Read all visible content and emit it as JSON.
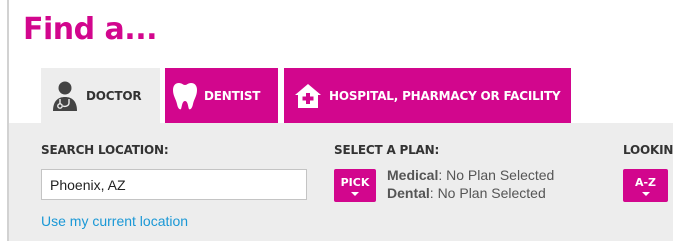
{
  "title": "Find a...",
  "tabs": [
    {
      "label": "DOCTOR",
      "icon": "doctor-icon",
      "active": true
    },
    {
      "label": "DENTIST",
      "icon": "tooth-icon",
      "active": false
    },
    {
      "label": "HOSPITAL, PHARMACY OR FACILITY",
      "icon": "hospital-icon",
      "active": false
    }
  ],
  "search": {
    "label": "SEARCH LOCATION:",
    "value": "Phoenix, AZ",
    "geo_link": "Use my current location"
  },
  "plan": {
    "label": "SELECT A PLAN:",
    "pick_label": "PICK",
    "medical_label": "Medical",
    "medical_value": ": No Plan Selected",
    "dental_label": "Dental",
    "dental_value": ": No Plan Selected"
  },
  "looking": {
    "label": "LOOKING",
    "az_label": "A-Z"
  },
  "colors": {
    "accent": "#d2068d",
    "panel": "#ededed",
    "link": "#1a98d6"
  }
}
